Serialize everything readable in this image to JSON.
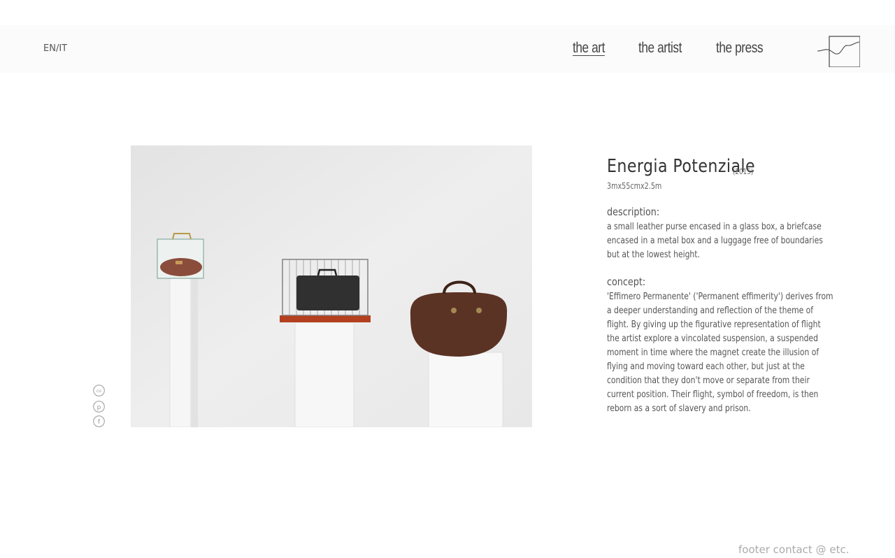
{
  "header": {
    "lang_switch": "EN/IT",
    "nav": [
      {
        "label": "the art",
        "active": true
      },
      {
        "label": "the artist",
        "active": false
      },
      {
        "label": "the  press",
        "active": false
      }
    ]
  },
  "artwork": {
    "title": "Energia Potenziale",
    "year": "(2015)",
    "dimensions": "3mx55cmx2.5m",
    "description_label": "description:",
    "description": "a small leather purse encased in a glass box, a briefcase encased in a metal box and a luggage free of boundaries but at the lowest height.",
    "concept_label": "concept:",
    "concept": "'Effimero Permanente' ('Permanent effimerity') derives from a deeper understanding and reflection of the theme of flight. By giving up  the figurative representation of flight the artist explore a vincolated suspension, a suspended moment in time where the magnet create the illusion of flying and moving toward each other, but just  at the condition that they don't move or separate from their current position. Their flight, symbol of freedom, is then reborn as a sort of slavery and prison."
  },
  "social": [
    {
      "icon": "contact-icon",
      "glyph": "co"
    },
    {
      "icon": "pinterest-icon",
      "glyph": "p"
    },
    {
      "icon": "facebook-icon",
      "glyph": "f"
    }
  ],
  "footer": {
    "text": "footer contact @ etc."
  },
  "colors": {
    "header_bg": "#fbfbfb",
    "text": "#555555",
    "footer_text": "#aaaaaa"
  }
}
